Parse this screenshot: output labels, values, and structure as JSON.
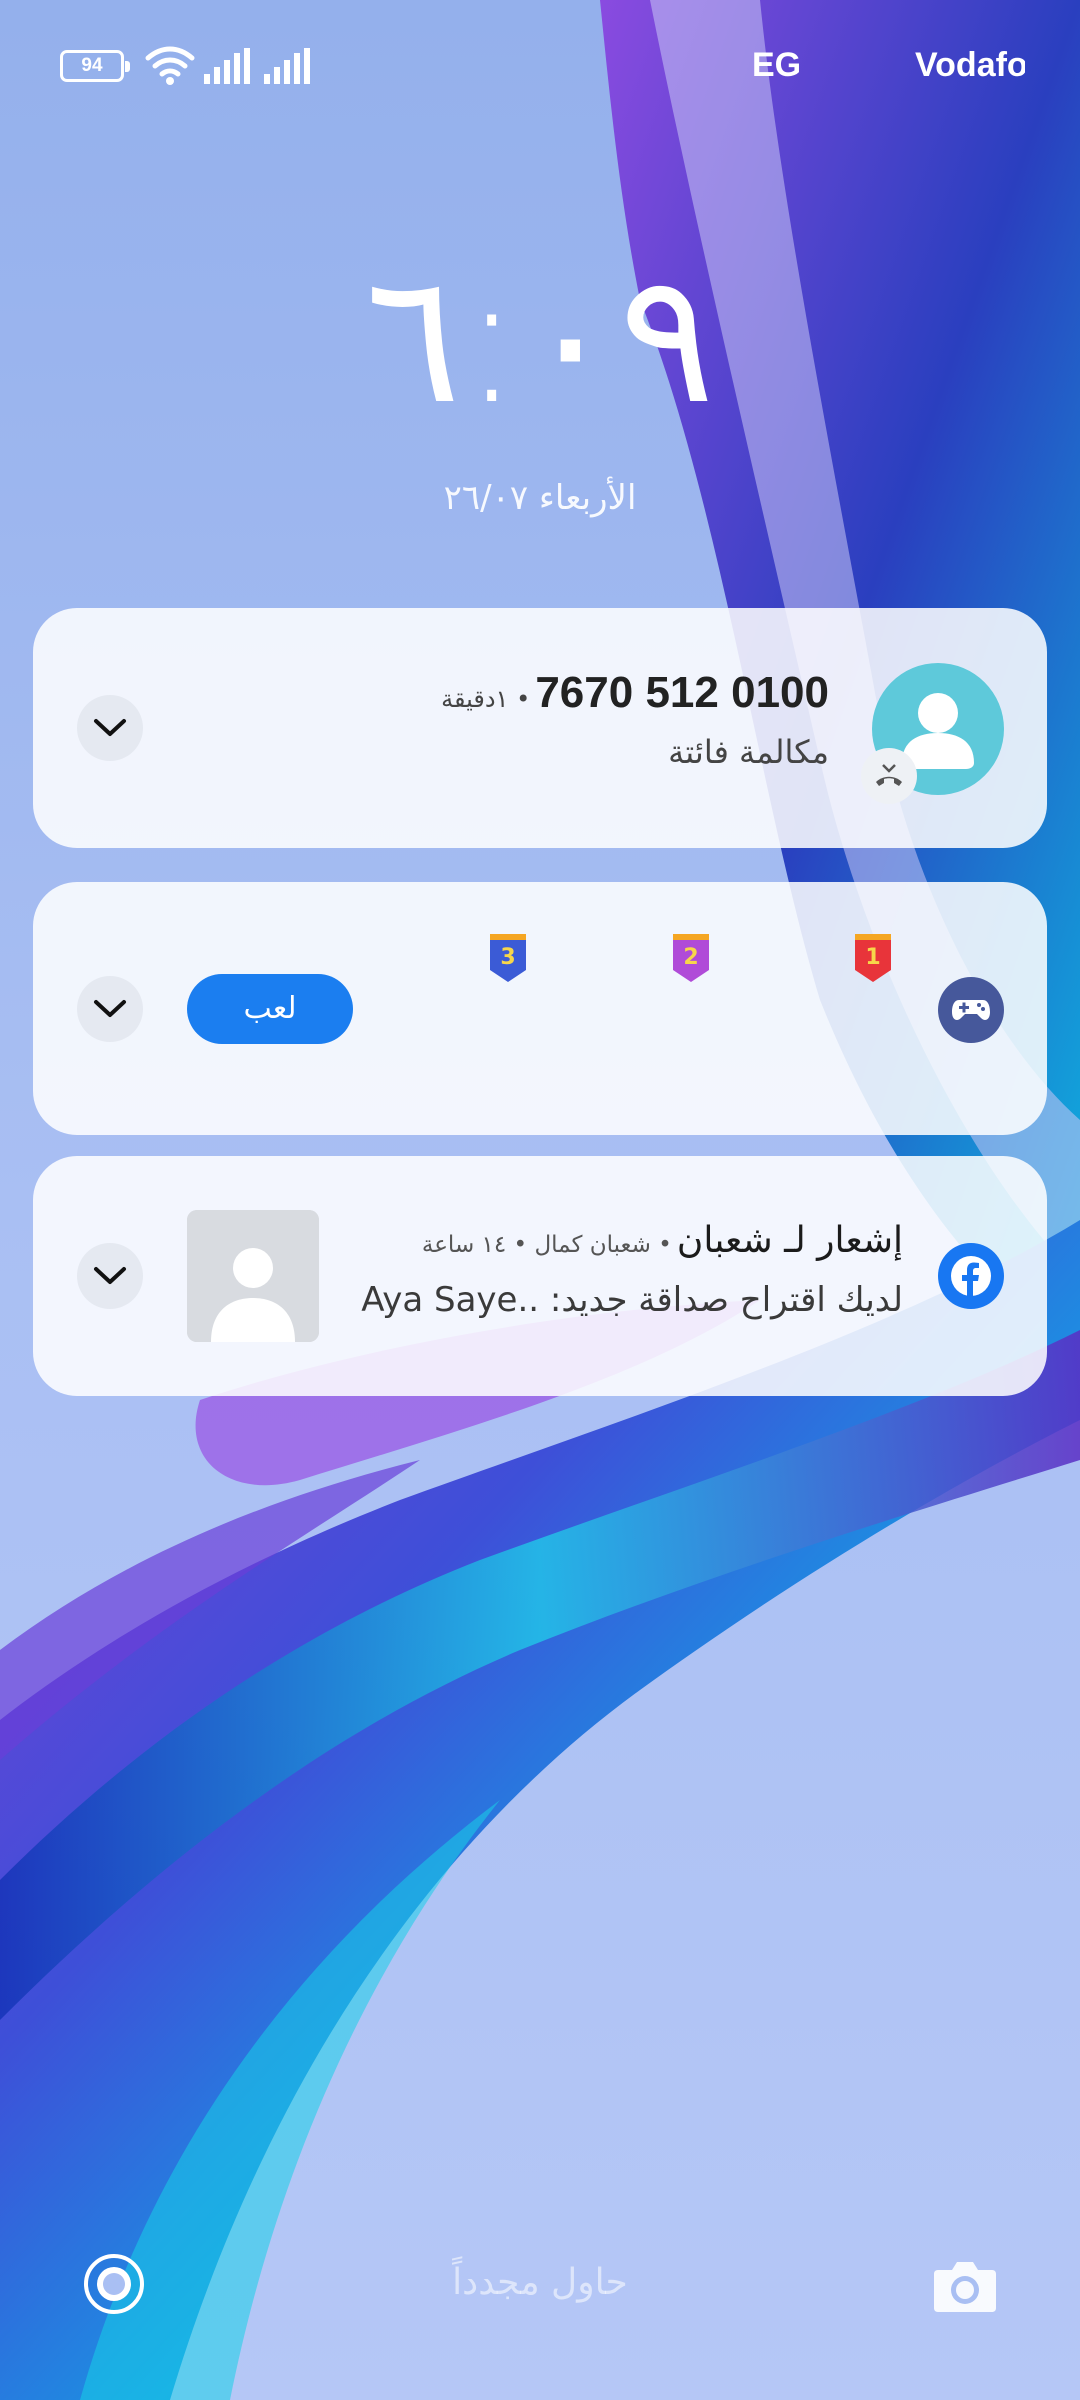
{
  "status_bar": {
    "battery_level": "94",
    "carrier_1": "EG",
    "carrier_2": "Vodafo",
    "icons": [
      "battery-icon",
      "wifi-icon",
      "signal-icon",
      "signal-icon"
    ]
  },
  "clock": {
    "time": "٦:٠٩",
    "date": "الأربعاء ٢٦/٠٧"
  },
  "notifications": [
    {
      "app_icon": "contact-avatar-icon",
      "badge_icon": "missed-call-icon",
      "title": "0100 512 7670",
      "meta": "• ١دقيقة",
      "body": "مكالمة فائتة"
    },
    {
      "app_icon": "gamepad-icon",
      "medals": [
        "1",
        "2",
        "3"
      ],
      "button_label": "لعب"
    },
    {
      "app_icon": "facebook-icon",
      "title": "إشعار لـ شعبان",
      "meta": "• شعبان كمال • ١٤ ساعة",
      "body": "لديك اقتراح صداقة جديد: ..Aya Saye"
    }
  ],
  "bottom": {
    "hint": "حاول مجدداً",
    "left_icon": "record-icon",
    "right_icon": "camera-icon"
  },
  "colors": {
    "wallpaper_base": "#a9bff3",
    "play_button": "#1b7ef0",
    "facebook": "#1877f2",
    "avatar_bg": "#5ec9da",
    "game_icon_bg": "#46589b"
  }
}
